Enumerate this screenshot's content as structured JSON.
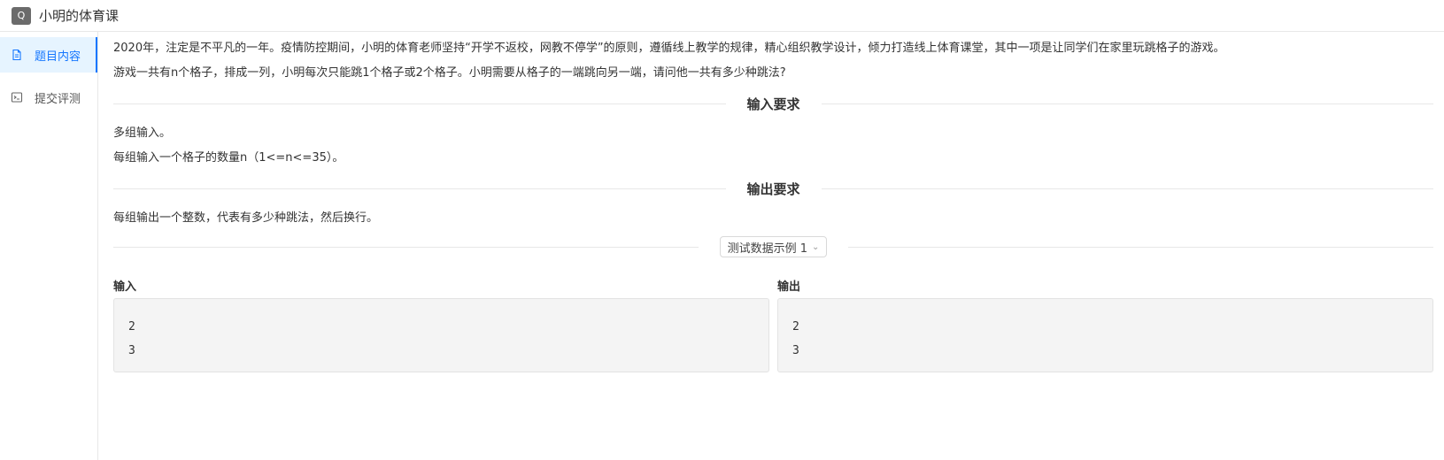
{
  "header": {
    "badge": "Q",
    "title": "小明的体育课"
  },
  "sidebar": {
    "items": [
      {
        "label": "题目内容",
        "icon": "document-icon",
        "active": true
      },
      {
        "label": "提交评测",
        "icon": "terminal-icon",
        "active": false
      }
    ]
  },
  "problem": {
    "description": [
      "2020年，注定是不平凡的一年。疫情防控期间，小明的体育老师坚持“开学不返校，网教不停学”的原则，遵循线上教学的规律，精心组织教学设计，倾力打造线上体育课堂，其中一项是让同学们在家里玩跳格子的游戏。",
      "游戏一共有n个格子，排成一列，小明每次只能跳1个格子或2个格子。小明需要从格子的一端跳向另一端，请问他一共有多少种跳法?"
    ],
    "input_heading": "输入要求",
    "input_text": [
      "多组输入。",
      "每组输入一个格子的数量n（1<=n<=35）。"
    ],
    "output_heading": "输出要求",
    "output_text": [
      "每组输出一个整数，代表有多少种跳法，然后换行。"
    ],
    "sample_select": "测试数据示例 1",
    "sample": {
      "input_label": "输入",
      "output_label": "输出",
      "input_lines": [
        "2",
        "3"
      ],
      "output_lines": [
        "2",
        "3"
      ]
    }
  },
  "colors": {
    "accent": "#1677ff",
    "active_bg": "#e6f4ff"
  }
}
